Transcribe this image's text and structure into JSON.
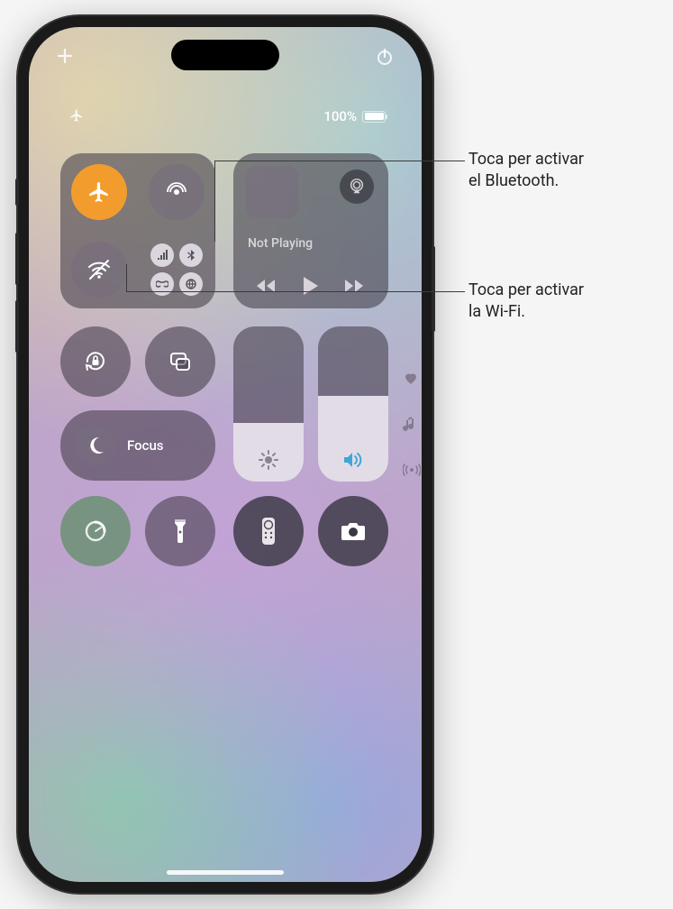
{
  "header": {
    "add_icon": "plus-icon",
    "power_icon": "power-icon"
  },
  "status": {
    "battery_text": "100%",
    "battery_level": 100
  },
  "connectivity": {
    "airplane": {
      "active": true
    },
    "airdrop": {
      "active": false
    },
    "wifi": {
      "active": false
    },
    "cluster": [
      "cellular-icon",
      "bluetooth-icon",
      "personal-hotspot-icon",
      "vpn-icon"
    ]
  },
  "media": {
    "title": "Not Playing"
  },
  "focus": {
    "label": "Focus"
  },
  "sliders": {
    "brightness_pct": 38,
    "volume_pct": 55
  },
  "callouts": {
    "bluetooth": "Toca per activar\nel Bluetooth.",
    "wifi": "Toca per activar\nla Wi-Fi."
  }
}
